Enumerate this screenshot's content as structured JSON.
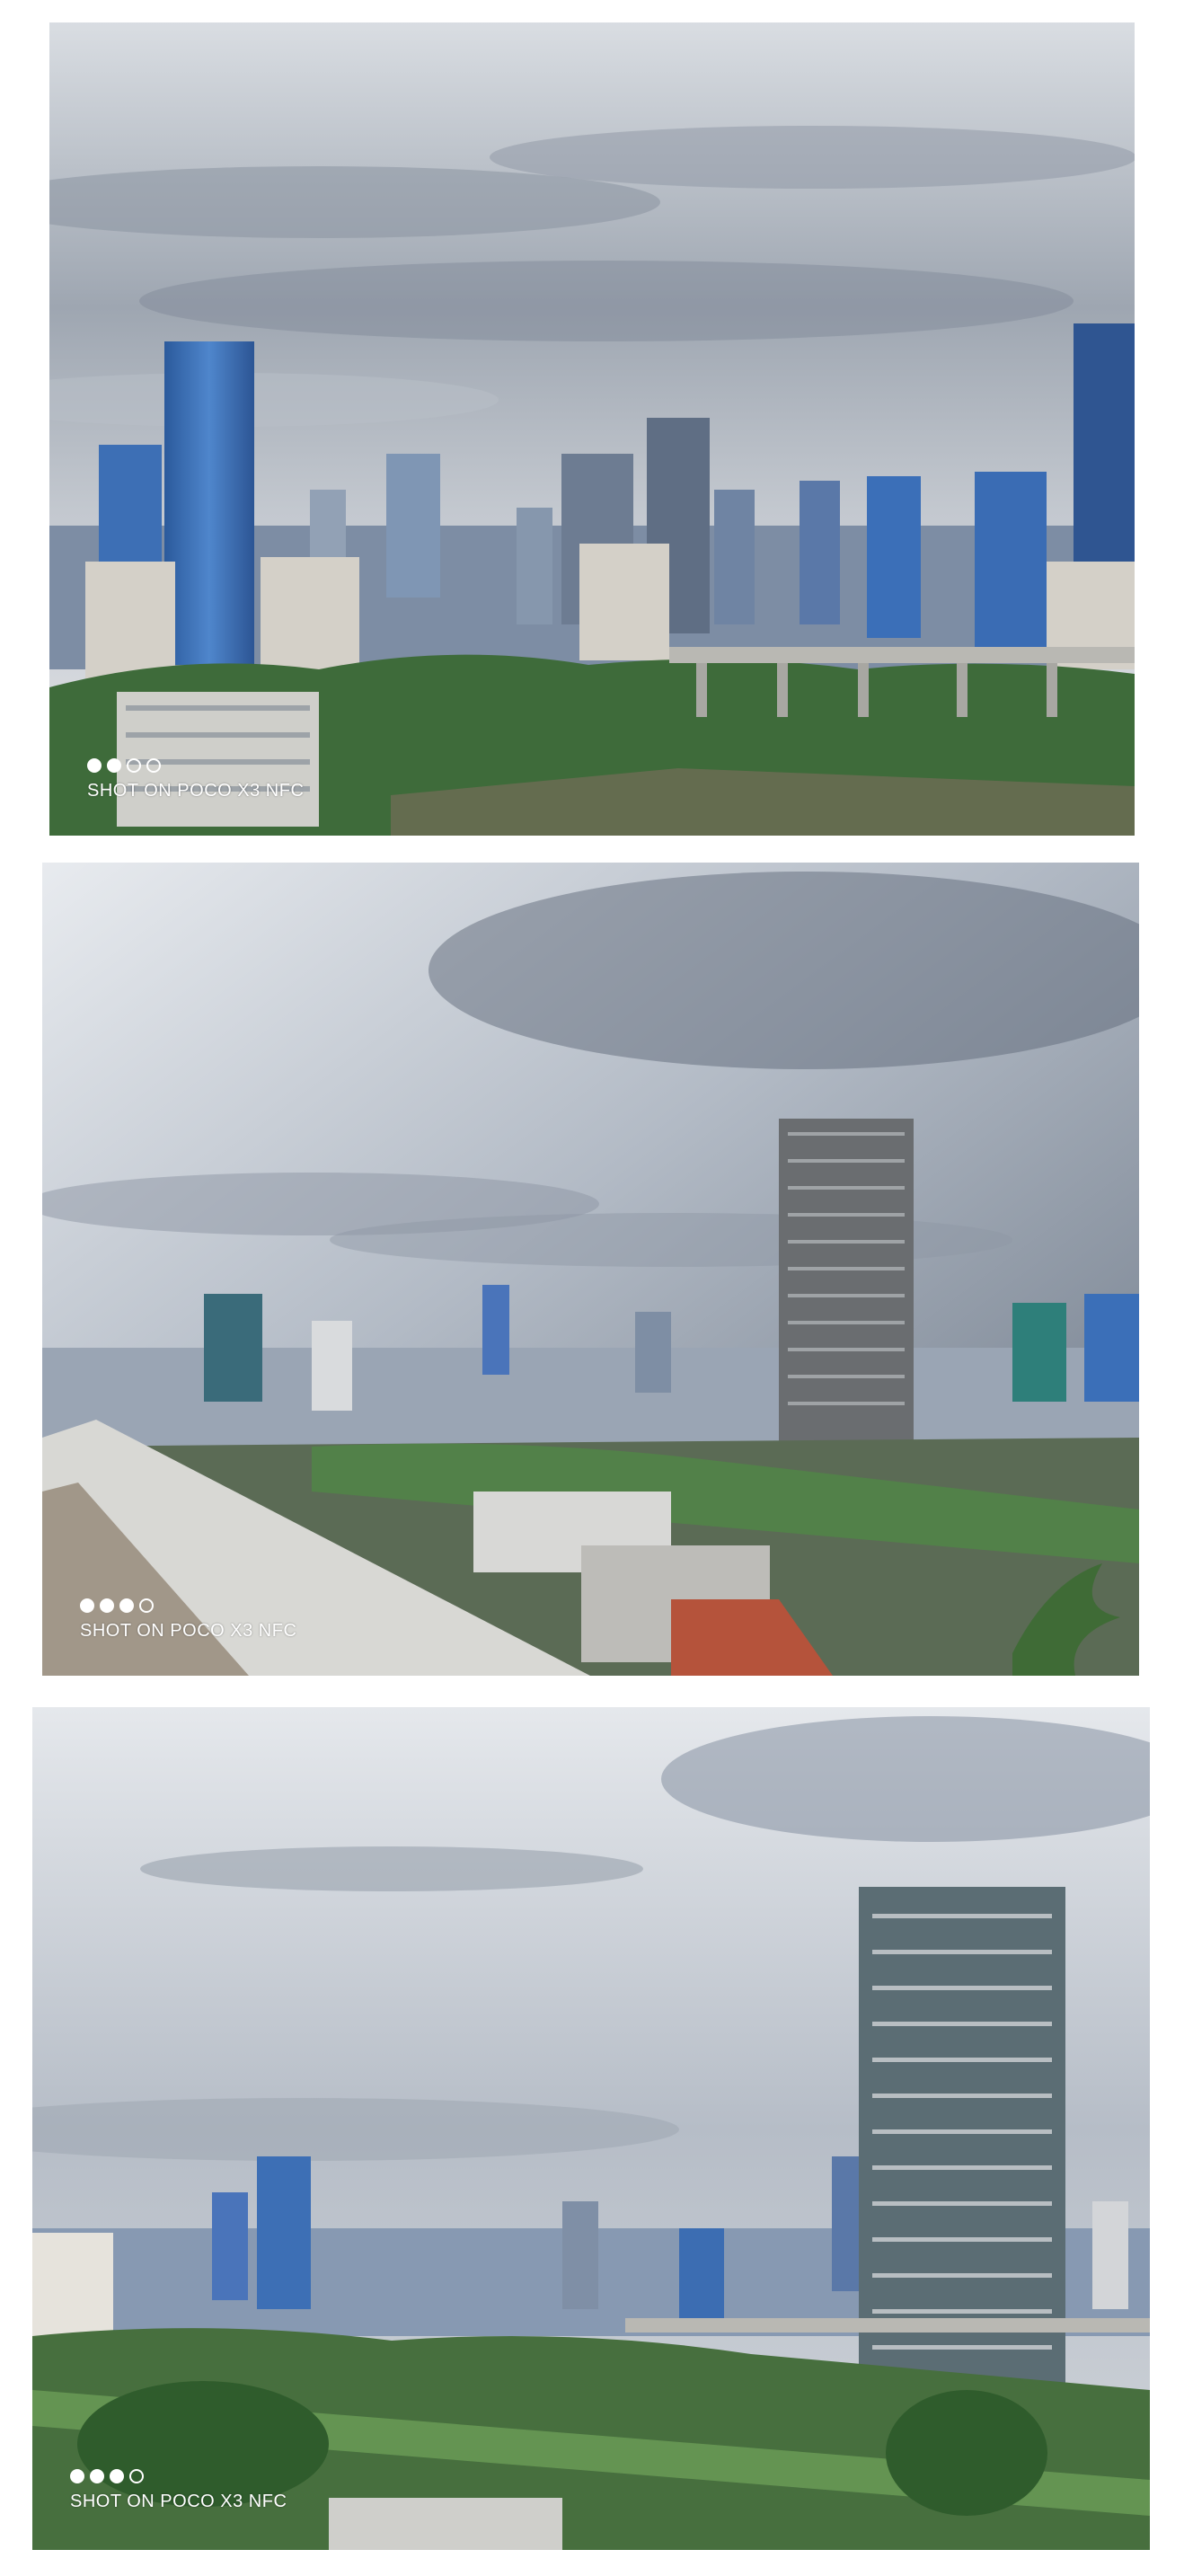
{
  "photos": [
    {
      "scene": "city-skyline-under-clouds",
      "watermark": {
        "text": "SHOT ON POCO X3 NFC",
        "dots_filled": 2,
        "dots_total": 4
      }
    },
    {
      "scene": "wide-angle-skyline-with-tall-tower-and-rooftop",
      "watermark": {
        "text": "SHOT ON POCO X3 NFC",
        "dots_filled": 3,
        "dots_total": 4
      }
    },
    {
      "scene": "skyline-with-tall-residential-tower",
      "watermark": {
        "text": "SHOT ON POCO X3 NFC",
        "dots_filled": 3,
        "dots_total": 4
      }
    }
  ],
  "colors": {
    "sky_light": "#dde1e6",
    "sky_dark": "#7f8896",
    "glass_blue": "#3f72b8",
    "greenery": "#3e6b3a",
    "concrete": "#c9c9c4"
  }
}
